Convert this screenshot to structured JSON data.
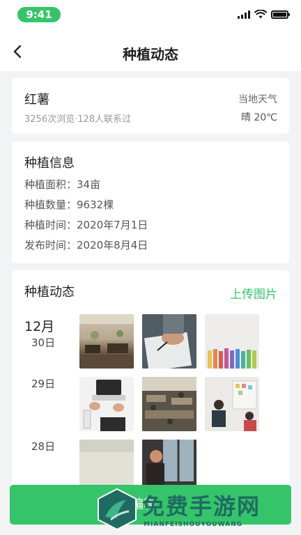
{
  "status_bar": {
    "time": "9:41"
  },
  "header": {
    "title": "种植动态"
  },
  "crop": {
    "name": "红薯",
    "stats": "3256次浏览·128人联系过",
    "weather_label": "当地天气",
    "weather_value": "晴 20℃"
  },
  "planting_info": {
    "title": "种植信息",
    "rows": [
      "种植面积：34亩",
      "种植数量：9632棵",
      "种植时间：2020年7月1日",
      "发布时间：2020年8月4日"
    ]
  },
  "dynamics": {
    "title": "种植动态",
    "upload_label": "上传图片",
    "month": "12月",
    "days": [
      "30日",
      "29日",
      "28日"
    ]
  },
  "bottom_button": {
    "label": "编辑"
  },
  "watermark": {
    "title": "免费手游网",
    "subtitle": "MIANFEISHOUYOUWANG"
  },
  "colors": {
    "accent": "#35c46a",
    "background": "#f2f3f5"
  },
  "icons": {
    "back": "chevron-left-icon",
    "signal": "signal-icon",
    "wifi": "wifi-icon",
    "battery": "battery-icon"
  }
}
